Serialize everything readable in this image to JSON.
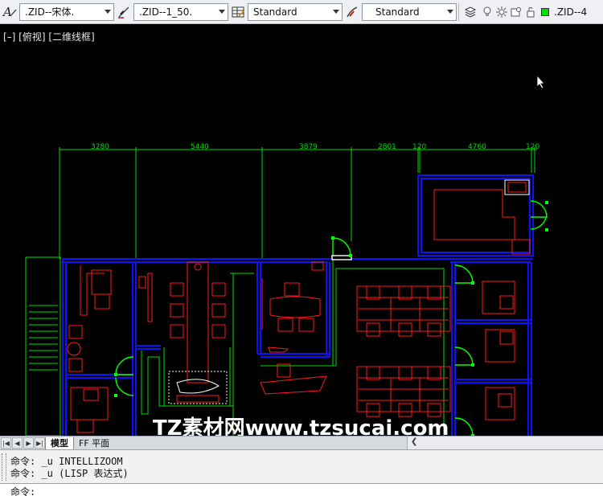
{
  "toolbar": {
    "text_style": ".ZID--宋体.",
    "dim_style": ".ZID--1_50.",
    "table_style": "Standard",
    "mleader_style": "Standard",
    "layer": ".ZID--4"
  },
  "viewport": {
    "label": "[–] [俯视] [二维线框]",
    "dimensions": [
      "3280",
      "5440",
      "3879",
      "2801",
      "120",
      "4760",
      "120"
    ],
    "watermark": "TZ素材网www.tzsucai.com"
  },
  "tabs": {
    "model": "模型",
    "layout": "FF 平面"
  },
  "command": {
    "line1": "命令: _u INTELLIZOOM",
    "line2": "命令: _u (LISP 表达式)",
    "prompt": "命令:"
  },
  "colors": {
    "wall": "#1010ff",
    "furniture": "#ff1a1a",
    "dimension": "#00dd00",
    "door": "#00ff00"
  }
}
